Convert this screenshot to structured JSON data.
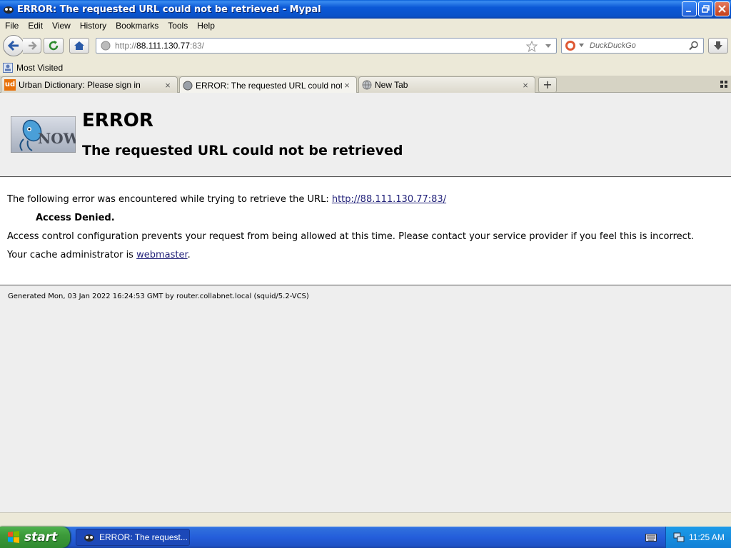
{
  "window": {
    "title": "ERROR: The requested URL could not be retrieved - Mypal"
  },
  "menu": {
    "items": [
      "File",
      "Edit",
      "View",
      "History",
      "Bookmarks",
      "Tools",
      "Help"
    ]
  },
  "nav": {
    "url_scheme": "http://",
    "url_host": "88.111.130.77",
    "url_port_path": ":83/",
    "search_placeholder": "DuckDuckGo"
  },
  "bookmarks": {
    "most_visited": "Most Visited"
  },
  "tabs": [
    {
      "label": "Urban Dictionary: Please sign in",
      "icon": "urban-dictionary-icon"
    },
    {
      "label": "ERROR: The requested URL could not be...",
      "icon": "squid-icon"
    },
    {
      "label": "New Tab",
      "icon": "globe-icon"
    }
  ],
  "page": {
    "h1": "ERROR",
    "h2": "The requested URL could not be retrieved",
    "intro": "The following error was encountered while trying to retrieve the URL: ",
    "url_link": "http://88.111.130.77:83/",
    "denied": "Access Denied.",
    "explanation": "Access control configuration prevents your request from being allowed at this time. Please contact your service provider if you feel this is incorrect.",
    "admin_prefix": "Your cache administrator is ",
    "admin_link": "webmaster",
    "admin_suffix": ".",
    "footer": "Generated Mon, 03 Jan 2022 16:24:53 GMT by router.collabnet.local (squid/5.2-VCS)",
    "logo_text": "NOW"
  },
  "taskbar": {
    "start": "start",
    "task_label": "ERROR: The request...",
    "clock": "11:25 AM"
  },
  "colors": {
    "titlebar": "#0b58d6",
    "link": "#22227a",
    "start_green": "#3c9a3a"
  }
}
